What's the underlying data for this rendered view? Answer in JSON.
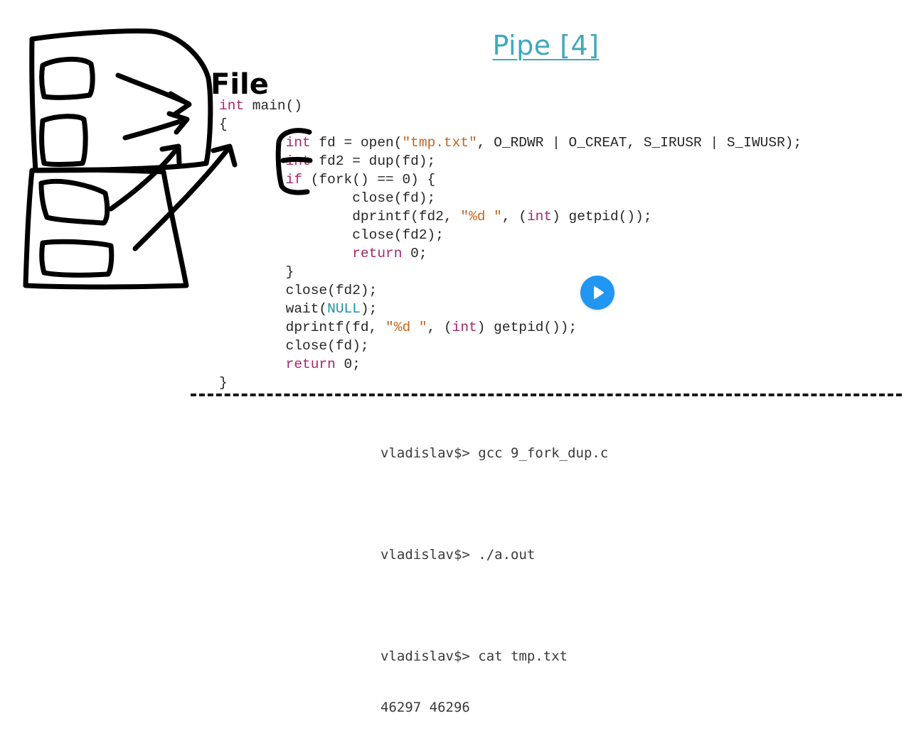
{
  "slide": {
    "title": "Pipe [4]",
    "handwritten_label": "File"
  },
  "code": {
    "l1_kw": "int",
    "l1_rest": " main()",
    "l2": "{",
    "l3_indent": "        ",
    "l3_kw": "int",
    "l3_a": " fd = open(",
    "l3_str": "\"tmp.txt\"",
    "l3_b": ", O_RDWR | O_CREAT, S_IRUSR | S_IWUSR);",
    "l4_indent": "        ",
    "l4_kw": "int",
    "l4_rest": " fd2 = dup(fd);",
    "l5_indent": "        ",
    "l5_kw": "if",
    "l5_rest": " (fork() == 0) {",
    "l6": "                close(fd);",
    "l7_a": "                dprintf(fd2, ",
    "l7_str": "\"%d \"",
    "l7_b": ", (",
    "l7_kw": "int",
    "l7_c": ") getpid());",
    "l8": "                close(fd2);",
    "l9_indent": "                ",
    "l9_kw": "return",
    "l9_rest": " 0;",
    "l10": "        }",
    "l11": "        close(fd2);",
    "l12_a": "        wait(",
    "l12_null": "NULL",
    "l12_b": ");",
    "l13_a": "        dprintf(fd, ",
    "l13_str": "\"%d \"",
    "l13_b": ", (",
    "l13_kw": "int",
    "l13_c": ") getpid());",
    "l14": "        close(fd);",
    "l15_indent": "        ",
    "l15_kw": "return",
    "l15_rest": " 0;",
    "l16": "}"
  },
  "terminal": {
    "cmd1": "vladislav$> gcc 9_fork_dup.c",
    "cmd2": "vladislav$> ./a.out",
    "cmd3": "vladislav$> cat tmp.txt",
    "output": "46297 46296"
  },
  "player": {
    "icon": "play-icon",
    "accent": "#2196f3"
  }
}
